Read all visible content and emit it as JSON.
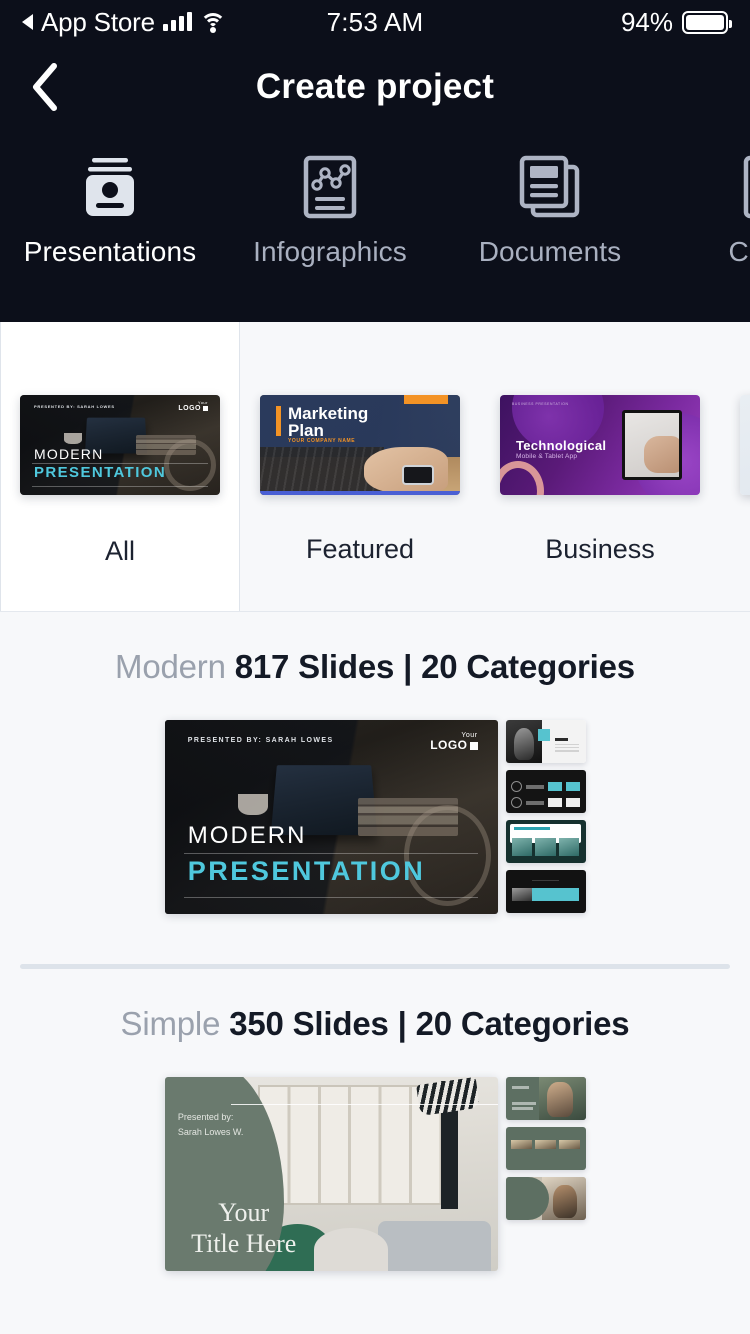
{
  "status_bar": {
    "carrier_back_label": "App Store",
    "time": "7:53 AM",
    "battery_percent": "94%",
    "signal_icon": "cellular-signal-icon",
    "wifi_icon": "wifi-icon",
    "battery_icon": "battery-icon"
  },
  "nav": {
    "title": "Create project",
    "back_icon": "chevron-left-icon"
  },
  "category_tabs": [
    {
      "label": "Presentations",
      "icon": "presentation-board-icon",
      "active": true
    },
    {
      "label": "Infographics",
      "icon": "infographic-chart-icon",
      "active": false
    },
    {
      "label": "Documents",
      "icon": "stacked-documents-icon",
      "active": false
    },
    {
      "label": "Charts",
      "icon": "charts-icon",
      "active": false
    }
  ],
  "filter_carousel": [
    {
      "label": "All",
      "selected": true,
      "thumbnail": {
        "style": "modern",
        "presented_by": "PRESENTED BY: SARAH LOWES",
        "logo_line1": "Your",
        "logo_line2": "LOGO",
        "title": "MODERN",
        "subtitle": "PRESENTATION"
      }
    },
    {
      "label": "Featured",
      "selected": false,
      "thumbnail": {
        "style": "marketing",
        "title_line1": "Marketing",
        "title_line2": "Plan",
        "subtitle": "YOUR COMPANY NAME"
      }
    },
    {
      "label": "Business",
      "selected": false,
      "thumbnail": {
        "style": "technological",
        "eyebrow": "BUSINESS PRESENTATION",
        "title": "Technological",
        "subtitle": "Mobile & Tablet App"
      }
    },
    {
      "label": "",
      "selected": false,
      "thumbnail": {
        "style": "partial"
      }
    }
  ],
  "sections": [
    {
      "name_muted": "Modern",
      "name_strong": "817 Slides | 20 Categories",
      "slide_count": "817",
      "category_count": "20",
      "preview": {
        "style": "modern",
        "presented_by": "PRESENTED BY: SARAH LOWES",
        "logo_line1": "Your",
        "logo_line2": "LOGO",
        "title": "MODERN",
        "subtitle": "PRESENTATION"
      },
      "mini_slides": [
        {
          "name": "welcome-slide",
          "label": "WELCOME"
        },
        {
          "name": "dark-list-slide",
          "label": ""
        },
        {
          "name": "meet-the-team-slide",
          "label": "Meet The Team"
        },
        {
          "name": "quote-slide",
          "label": ""
        }
      ]
    },
    {
      "name_muted": "Simple",
      "name_strong": "350 Slides | 20 Categories",
      "slide_count": "350",
      "category_count": "20",
      "preview": {
        "style": "simple",
        "presented_by_line1": "Presented by:",
        "presented_by_line2": "Sarah Lowes W.",
        "title_line1": "Your",
        "title_line2": "Title Here"
      },
      "mini_slides": [
        {
          "name": "sage-portrait-slide",
          "label": ""
        },
        {
          "name": "sage-gallery-slide",
          "label": ""
        },
        {
          "name": "sage-split-slide",
          "label": ""
        }
      ]
    }
  ],
  "colors": {
    "header_bg": "#0c0f1a",
    "page_bg": "#f7f8fa",
    "accent_cyan": "#4fc8dd",
    "accent_orange": "#f39325",
    "divider": "#dde3ea",
    "text_dark": "#141a26",
    "text_muted": "#9aa1ad",
    "tab_inactive": "#a9b0c0"
  }
}
